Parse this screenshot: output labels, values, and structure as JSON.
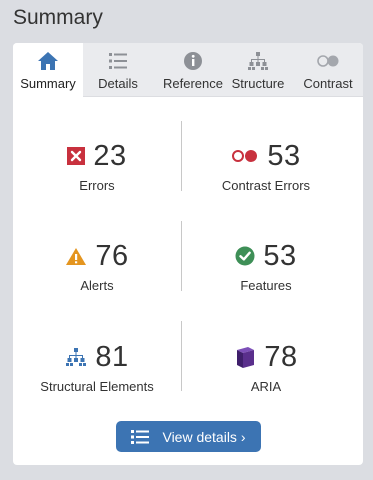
{
  "page": {
    "title": "Summary"
  },
  "tabs": [
    {
      "label": "Summary",
      "icon": "home-icon",
      "active": true
    },
    {
      "label": "Details",
      "icon": "list-icon",
      "active": false
    },
    {
      "label": "Reference",
      "icon": "info-icon",
      "active": false
    },
    {
      "label": "Structure",
      "icon": "hierarchy-icon",
      "active": false
    },
    {
      "label": "Contrast",
      "icon": "contrast-icon",
      "active": false
    }
  ],
  "stats": {
    "errors": {
      "value": "23",
      "label": "Errors",
      "icon": "error-x-icon",
      "color": "#c8313e"
    },
    "contrast_errors": {
      "value": "53",
      "label": "Contrast Errors",
      "icon": "contrast-icon",
      "color": "#c8313e"
    },
    "alerts": {
      "value": "76",
      "label": "Alerts",
      "icon": "alert-triangle-icon",
      "color": "#e4951f"
    },
    "features": {
      "value": "53",
      "label": "Features",
      "icon": "check-circle-icon",
      "color": "#3e8f57"
    },
    "structural": {
      "value": "81",
      "label": "Structural Elements",
      "icon": "hierarchy-icon",
      "color": "#3c74b3"
    },
    "aria": {
      "value": "78",
      "label": "ARIA",
      "icon": "aria-cube-icon",
      "color": "#5a2f8c"
    }
  },
  "actions": {
    "view_details_label": "View details ›"
  },
  "colors": {
    "accent": "#3c74b3",
    "panel_bg": "#ffffff",
    "page_bg": "#dbdde2"
  }
}
